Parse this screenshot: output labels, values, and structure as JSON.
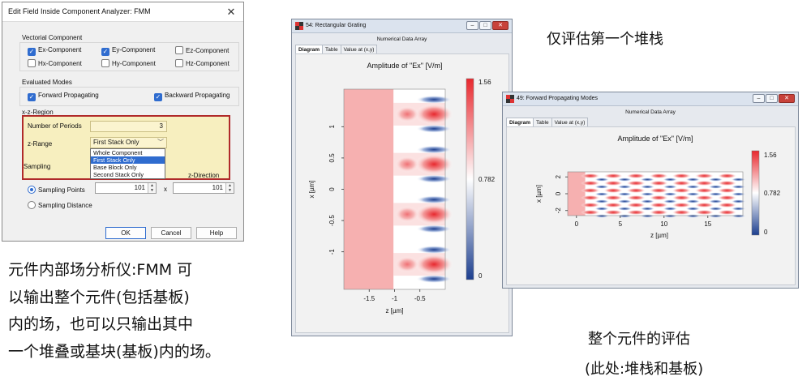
{
  "dialog": {
    "title": "Edit Field Inside Component Analyzer: FMM",
    "close_glyph": "✕",
    "vectorial": {
      "label": "Vectorial Component",
      "items": [
        {
          "label": "Ex-Component",
          "checked": true
        },
        {
          "label": "Ey-Component",
          "checked": true
        },
        {
          "label": "Ez-Component",
          "checked": false
        },
        {
          "label": "Hx-Component",
          "checked": false
        },
        {
          "label": "Hy-Component",
          "checked": false
        },
        {
          "label": "Hz-Component",
          "checked": false
        }
      ]
    },
    "modes": {
      "label": "Evaluated Modes",
      "forward": {
        "label": "Forward Propagating",
        "checked": true
      },
      "backward": {
        "label": "Backward Propagating",
        "checked": true
      }
    },
    "region": {
      "label": "x-z-Region",
      "periods_label": "Number of Periods",
      "periods_value": "3",
      "zrange_label": "z-Range",
      "zrange_value": "First Stack Only",
      "options": [
        "Whole Component",
        "First Stack Only",
        "Base Block Only",
        "Second Stack Only"
      ],
      "selected_option": "First Stack Only"
    },
    "sampling": {
      "label": "Sampling",
      "zdir_label": "z-Direction",
      "points_label": "Sampling Points",
      "points_x": "101",
      "times": "x",
      "points_z": "101",
      "distance_label": "Sampling Distance",
      "selected": "Sampling Points"
    },
    "buttons": {
      "ok": "OK",
      "cancel": "Cancel",
      "help": "Help"
    }
  },
  "captions": {
    "left_line1": "元件内部场分析仪:FMM 可",
    "left_line2": "以输出整个元件(包括基板)",
    "left_line3": "内的场，也可以只输出其中",
    "left_line4": "一个堆叠或基块(基板)内的场。",
    "top_right": "仅评估第一个堆栈",
    "bottom_right_line1": "整个元件的评估",
    "bottom_right_line2": "(此处:堆栈和基板)"
  },
  "window1": {
    "title": "54: Rectangular Grating",
    "subtitle": "Numerical Data Array",
    "tabs": [
      "Diagram",
      "Table",
      "Value at (x,y)"
    ],
    "active_tab": "Diagram",
    "icons": [
      "window-icon",
      "minimize-icon",
      "maximize-icon",
      "close-icon"
    ]
  },
  "window2": {
    "title": "49: Forward Propagating Modes",
    "subtitle": "Numerical Data Array",
    "tabs": [
      "Diagram",
      "Table",
      "Value at (x,y)"
    ],
    "active_tab": "Diagram"
  },
  "colors": {
    "high": "#e8282e",
    "mid": "#ffffff",
    "low": "#1d3f8f",
    "accent": "#2f6ccf",
    "region_border": "#b02a2a"
  },
  "chart_data": [
    {
      "type": "heatmap",
      "title": "Amplitude of \"Ex\"  [V/m]",
      "xlabel": "z [µm]",
      "ylabel": "x [µm]",
      "xlim": [
        -2.0,
        0.0
      ],
      "ylim": [
        -1.6,
        1.6
      ],
      "x_ticks": [
        "-1.5",
        "-1",
        "-0.5"
      ],
      "y_ticks": [
        "1",
        "0.5",
        "0",
        "-0.5",
        "-1"
      ],
      "colorbar": {
        "min": "0",
        "mid": "0.782",
        "max": "1.56"
      },
      "field_rows": [
        1.2,
        0.4,
        -0.4,
        -1.2
      ],
      "uniform_value": 0.9
    },
    {
      "type": "heatmap",
      "title": "Amplitude of \"Ex\"  [V/m]",
      "xlabel": "z [µm]",
      "ylabel": "x [µm]",
      "xlim": [
        -1,
        19
      ],
      "ylim": [
        -2.6,
        2.6
      ],
      "x_ticks": [
        "0",
        "5",
        "10",
        "15"
      ],
      "y_ticks": [
        "2",
        "0",
        "-2"
      ],
      "colorbar": {
        "min": "0",
        "mid": "0.782",
        "max": "1.56"
      }
    }
  ]
}
